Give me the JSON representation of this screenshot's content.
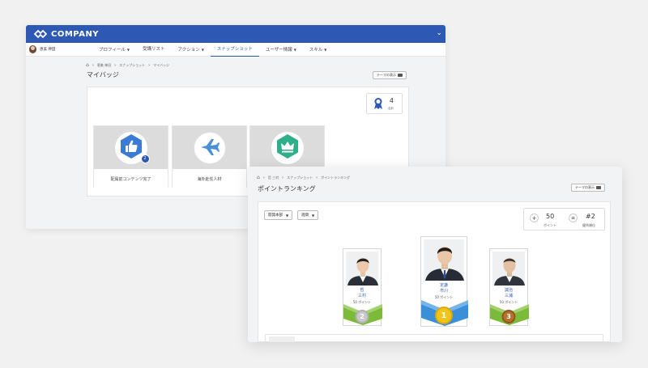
{
  "brand": {
    "name": "COMPANY"
  },
  "back_window": {
    "user_name": "恵美 神田",
    "nav": [
      {
        "label": "プロフィール",
        "caret": true
      },
      {
        "label": "受講リスト",
        "caret": false
      },
      {
        "label": "アクション",
        "caret": true
      },
      {
        "label": "スナップショット",
        "caret": false,
        "active": true
      },
      {
        "label": "ユーザー情報",
        "caret": true
      },
      {
        "label": "スキル",
        "caret": true
      }
    ],
    "breadcrumb": [
      "恵美 神田",
      "スナップショット",
      "マイバッジ"
    ],
    "title": "マイバッジ",
    "theme_button": "テーマの表示",
    "badge_count": {
      "value": "4",
      "label": "合計"
    },
    "badges": [
      {
        "label": "配属前コンテンツ完了",
        "icon": "thumbs-up-icon",
        "count": "2",
        "color": "#3a7bd5"
      },
      {
        "label": "海外赴任人材",
        "icon": "airplane-icon",
        "color": "#4a90d9"
      },
      {
        "label": "",
        "icon": "crown-icon",
        "color": "#2fae8a"
      }
    ]
  },
  "front_window": {
    "breadcrumb": [
      "哲 三村",
      "スナップショット",
      "ポイントランキング"
    ],
    "title": "ポイントランキング",
    "theme_button": "テーマの表示",
    "filters": [
      "開発本部",
      "週間"
    ],
    "stats": {
      "points_value": "50",
      "points_label": "ポイント",
      "rank_value": "#2",
      "rank_label": "優秀順位"
    },
    "podium": [
      {
        "rank": "2",
        "name_line1": "哲",
        "name_line2": "三村",
        "points": "50 ポイント",
        "medal_color": "#c9c9c9",
        "band": "#7cbb3a"
      },
      {
        "rank": "1",
        "name_line1": "定謙",
        "name_line2": "市川",
        "points": "50 ポイント",
        "medal_color": "#f0c419",
        "band": "#3a8fd9"
      },
      {
        "rank": "3",
        "name_line1": "誠治",
        "name_line2": "三浦",
        "points": "50 ポイント",
        "medal_color": "#b5722f",
        "band": "#7cbb3a"
      }
    ]
  }
}
